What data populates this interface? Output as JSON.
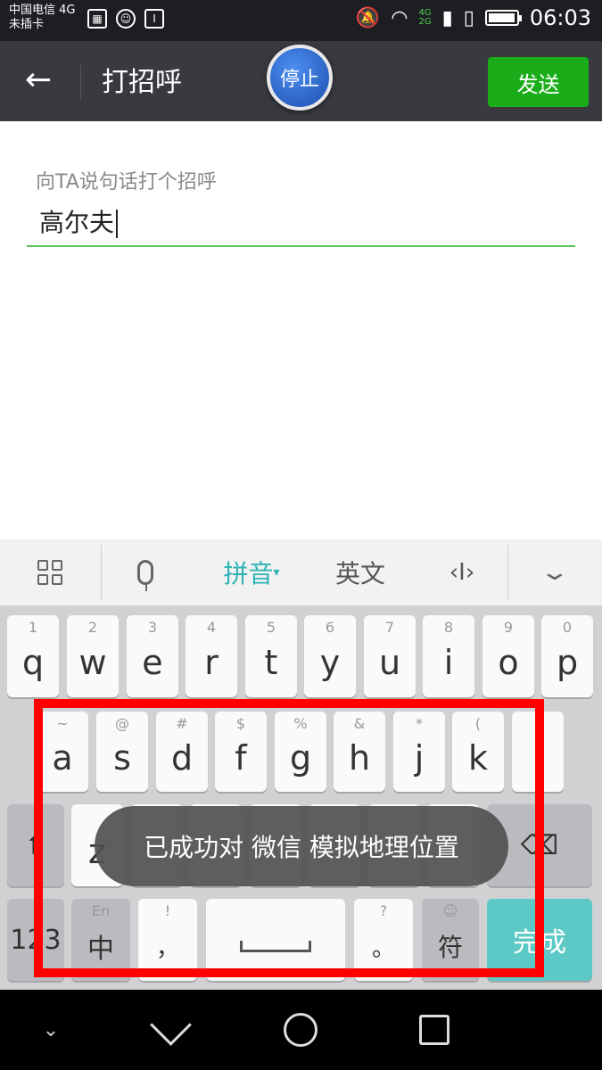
{
  "status_bar": {
    "carrier_line1": "中国电信 4G",
    "carrier_line2": "未插卡",
    "network_top": "4G",
    "network_bottom": "2G",
    "time": "06:03",
    "battery_level_percent": 95,
    "icons": [
      "image-icon",
      "face-icon",
      "notice-icon",
      "silent-icon",
      "wifi-icon",
      "signal-icon",
      "sim-icon",
      "battery-icon"
    ]
  },
  "title_bar": {
    "back_icon": "back-arrow-icon",
    "title": "打招呼",
    "stop_label": "停止",
    "send_label": "发送"
  },
  "form": {
    "hint": "向TA说句话打个招呼",
    "value": "高尔夫"
  },
  "keyboard_toolbar": {
    "pinyin": "拼音",
    "english": "英文",
    "cursor": "‹I›"
  },
  "keyboard": {
    "row1": [
      {
        "num": "1",
        "key": "q"
      },
      {
        "num": "2",
        "key": "w"
      },
      {
        "num": "3",
        "key": "e"
      },
      {
        "num": "4",
        "key": "r"
      },
      {
        "num": "5",
        "key": "t"
      },
      {
        "num": "6",
        "key": "y"
      },
      {
        "num": "7",
        "key": "u"
      },
      {
        "num": "8",
        "key": "i"
      },
      {
        "num": "9",
        "key": "o"
      },
      {
        "num": "0",
        "key": "p"
      }
    ],
    "row2": [
      {
        "sym": "~",
        "key": "a"
      },
      {
        "sym": "@",
        "key": "s"
      },
      {
        "sym": "#",
        "key": "d"
      },
      {
        "sym": "$",
        "key": "f"
      },
      {
        "sym": "%",
        "key": "g"
      },
      {
        "sym": "&",
        "key": "h"
      },
      {
        "sym": "*",
        "key": "j"
      },
      {
        "sym": "(",
        "key": "k"
      },
      {
        "sym": "",
        "key": ""
      }
    ],
    "row3_z": "z",
    "row4": {
      "num_key": "123",
      "lang_sub": "En",
      "lang_main": "中",
      "comma_sub": "!",
      "comma_main": "，",
      "period_sub": "?",
      "period_main": "。",
      "sym_sub": "☺",
      "sym_main": "符",
      "done": "完成"
    }
  },
  "toast": {
    "message": "已成功对 微信 模拟地理位置"
  },
  "colors": {
    "title_bar": "#393a3f",
    "send_button": "#1aad19",
    "accent_teal": "#2cb3b5",
    "highlight": "#ff0000"
  }
}
